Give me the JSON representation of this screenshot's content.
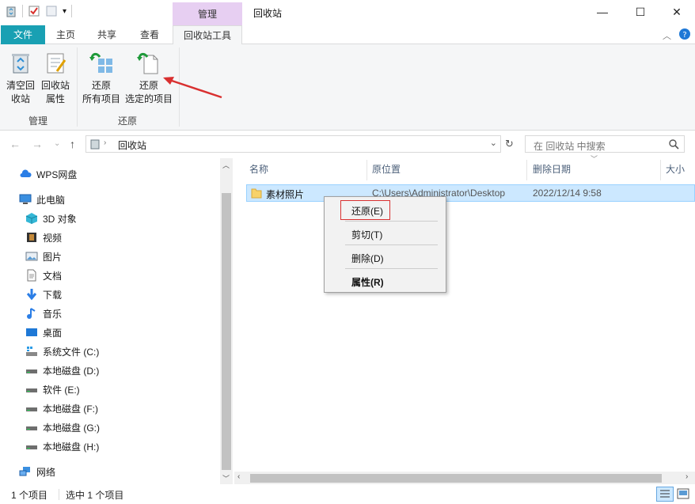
{
  "window": {
    "title": "回收站",
    "contextual_tab_group": "管理",
    "controls": {
      "minimize": "—",
      "maximize": "☐",
      "close": "✕"
    }
  },
  "ribbon_tabs": {
    "file": "文件",
    "home": "主页",
    "share": "共享",
    "view": "查看",
    "recycle_tools": "回收站工具"
  },
  "ribbon": {
    "empty_recycle_line1": "清空回",
    "empty_recycle_line2": "收站",
    "properties_line1": "回收站",
    "properties_line2": "属性",
    "restore_all_line1": "还原",
    "restore_all_line2": "所有项目",
    "restore_selected_line1": "还原",
    "restore_selected_line2": "选定的项目",
    "group_manage": "管理",
    "group_restore": "还原"
  },
  "address": {
    "crumb": "回收站",
    "search_placeholder": "在 回收站 中搜索"
  },
  "nav": {
    "items": [
      {
        "label": "WPS网盘",
        "icon": "cloud-icon"
      },
      {
        "label": "此电脑",
        "icon": "computer-icon"
      },
      {
        "label": "3D 对象",
        "icon": "cube-icon"
      },
      {
        "label": "视频",
        "icon": "video-icon"
      },
      {
        "label": "图片",
        "icon": "picture-icon"
      },
      {
        "label": "文档",
        "icon": "document-icon"
      },
      {
        "label": "下载",
        "icon": "download-icon"
      },
      {
        "label": "音乐",
        "icon": "music-icon"
      },
      {
        "label": "桌面",
        "icon": "desktop-icon"
      },
      {
        "label": "系统文件 (C:)",
        "icon": "system-drive-icon"
      },
      {
        "label": "本地磁盘 (D:)",
        "icon": "drive-icon"
      },
      {
        "label": "软件 (E:)",
        "icon": "drive-icon"
      },
      {
        "label": "本地磁盘 (F:)",
        "icon": "drive-icon"
      },
      {
        "label": "本地磁盘 (G:)",
        "icon": "drive-icon"
      },
      {
        "label": "本地磁盘 (H:)",
        "icon": "drive-icon"
      },
      {
        "label": "网络",
        "icon": "network-icon"
      }
    ]
  },
  "filelist": {
    "columns": {
      "name": "名称",
      "original_location": "原位置",
      "date_deleted": "删除日期",
      "size": "大小"
    },
    "rows": [
      {
        "name": "素材照片",
        "original_location": "C:\\Users\\Administrator\\Desktop",
        "date_deleted": "2022/12/14 9:58"
      }
    ]
  },
  "context_menu": {
    "restore": "还原(E)",
    "cut": "剪切(T)",
    "delete": "删除(D)",
    "properties": "属性(R)"
  },
  "status": {
    "item_count": "1 个项目",
    "selected": "选中 1 个项目"
  },
  "colors": {
    "file_tab": "#19a0b3",
    "contextual_tab": "#e7cff2",
    "selection": "#cce8ff",
    "highlight_box": "#d93030"
  }
}
